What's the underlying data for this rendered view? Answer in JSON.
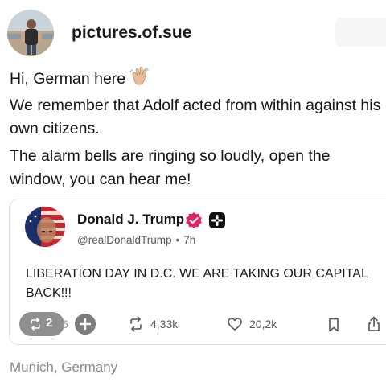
{
  "post": {
    "username": "pictures.of.sue",
    "paragraph1": "Hi, German here",
    "paragraph1_cont": "We remember that Adolf acted from within against his own citizens.",
    "paragraph2": "The alarm bells are ringing so loudly, open the window, you can hear me!",
    "location": "Munich, Germany"
  },
  "quote": {
    "name": "Donald J. Trump",
    "handle": "@realDonaldTrump",
    "dot": "•",
    "time": "7h",
    "text": "LIBERATION DAY IN D.C. WE ARE TAKING OUR CAPITAL BACK!!!",
    "actions": {
      "repost_pill_count": "2",
      "repost_pill_tail": "6",
      "reposts": "4,33k",
      "likes": "20,2k"
    }
  },
  "colors": {
    "verified": "#e0245e",
    "pill": "#8f8f8f",
    "muted": "#8a8a8a"
  },
  "icons": [
    "wave-emoji-icon",
    "verified-badge-icon",
    "plus-badge-icon",
    "repost-icon",
    "plus-icon",
    "heart-icon",
    "bookmark-icon",
    "share-icon"
  ]
}
